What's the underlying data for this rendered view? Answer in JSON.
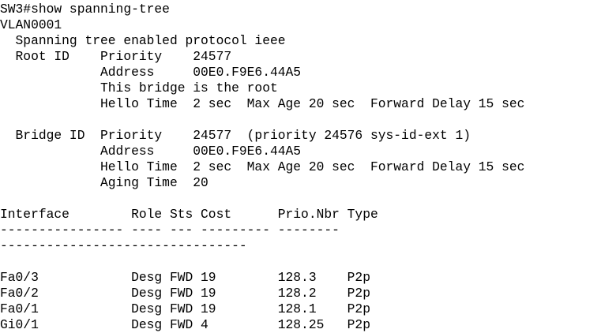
{
  "terminal": {
    "prompt": "SW3#show spanning-tree",
    "vlan": "VLAN0001",
    "protocol_line": "  Spanning tree enabled protocol ieee",
    "root_id": {
      "priority_line": "  Root ID    Priority    24577",
      "address_line": "             Address     00E0.F9E6.44A5",
      "root_note_line": "             This bridge is the root",
      "timers_line": "             Hello Time  2 sec  Max Age 20 sec  Forward Delay 15 sec"
    },
    "blank_1": "",
    "bridge_id": {
      "priority_line": "  Bridge ID  Priority    24577  (priority 24576 sys-id-ext 1)",
      "address_line": "             Address     00E0.F9E6.44A5",
      "timers_line": "             Hello Time  2 sec  Max Age 20 sec  Forward Delay 15 sec",
      "aging_line": "             Aging Time  20"
    },
    "blank_2": "",
    "table": {
      "header_line": "Interface        Role Sts Cost      Prio.Nbr Type",
      "separator_line_1": "---------------- ---- --- --------- --------",
      "separator_line_2": "--------------------------------",
      "blank": "",
      "rows": [
        {
          "interface": "Fa0/3",
          "role": "Desg",
          "sts": "FWD",
          "cost": "19",
          "prio_nbr": "128.3",
          "type": "P2p",
          "line": "Fa0/3            Desg FWD 19        128.3    P2p"
        },
        {
          "interface": "Fa0/2",
          "role": "Desg",
          "sts": "FWD",
          "cost": "19",
          "prio_nbr": "128.2",
          "type": "P2p",
          "line": "Fa0/2            Desg FWD 19        128.2    P2p"
        },
        {
          "interface": "Fa0/1",
          "role": "Desg",
          "sts": "FWD",
          "cost": "19",
          "prio_nbr": "128.1",
          "type": "P2p",
          "line": "Fa0/1            Desg FWD 19        128.1    P2p"
        },
        {
          "interface": "Gi0/1",
          "role": "Desg",
          "sts": "FWD",
          "cost": "4",
          "prio_nbr": "128.25",
          "type": "P2p",
          "line": "Gi0/1            Desg FWD 4         128.25   P2p"
        }
      ]
    }
  }
}
